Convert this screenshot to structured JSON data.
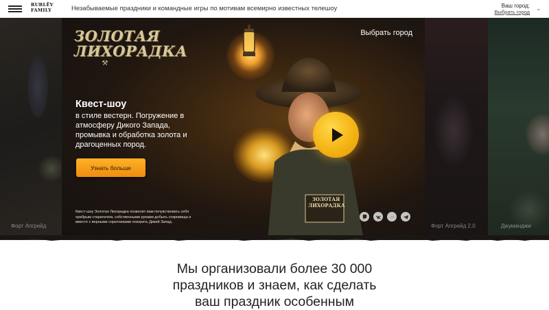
{
  "header": {
    "logo_line1": "RUBLËV",
    "logo_line2": "FAMILY",
    "tagline": "Незабываемые праздники и командные игры по мотивам всемирно известных телешоу",
    "city_label": "Ваш город:",
    "city_link": "Выбрать город"
  },
  "slider": {
    "left_caption": "Форт Апгрейд",
    "right_captions": [
      "Форт Апгрейд 2.0",
      "Джуманджи"
    ],
    "main": {
      "logo_line1": "ЗОЛОТАЯ",
      "logo_line2": "ЛИХОРАДКА",
      "choose_city": "Выбрать город",
      "title": "Квест-шоу",
      "description": "в стиле вестерн. Погружение в атмосферу Дикого Запада, промывка и обработка золота и драгоценных пород.",
      "button_label": "Узнать больше",
      "small_text": "Квест-шоу Золотая Лихорадка позволит вам почувствовать себя храбрым старателем, собственными руками добыть сокровища и вместе с верными соратниками покорить Дикий Запад.",
      "shirt_text": "ЗОЛОТАЯ ЛИХОРАДКА",
      "share_icons": [
        "viber-icon",
        "vk-icon",
        "messenger-icon",
        "telegram-icon"
      ]
    }
  },
  "content": {
    "heading": "Мы организовали более 30 000\nпраздников и знаем, как сделать\nваш праздник особенным"
  },
  "colors": {
    "accent": "#f5a623",
    "play": "#f4b414",
    "dark_bg": "#1a1614"
  }
}
